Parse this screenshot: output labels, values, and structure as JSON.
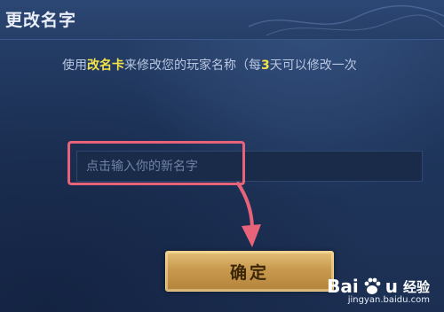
{
  "dialog": {
    "title": "更改名字",
    "description": {
      "prefix": "使用",
      "item": "改名卡",
      "middle": "来修改您的玩家名称（每",
      "days": "3",
      "suffix": "天可以修改一次"
    },
    "name_input": {
      "value": "",
      "placeholder": "点击输入你的新名字"
    },
    "confirm_label": "确定"
  },
  "annotation": {
    "box_color": "#e8627a",
    "arrow_color": "#e8627a"
  },
  "watermark": {
    "brand": "Bai",
    "brand2": "u",
    "service": "经验",
    "url": "jingyan.baidu.com"
  },
  "colors": {
    "highlight_text": "#f3e24a",
    "button_gold": "#c89a4e",
    "background": "#1f365c"
  }
}
